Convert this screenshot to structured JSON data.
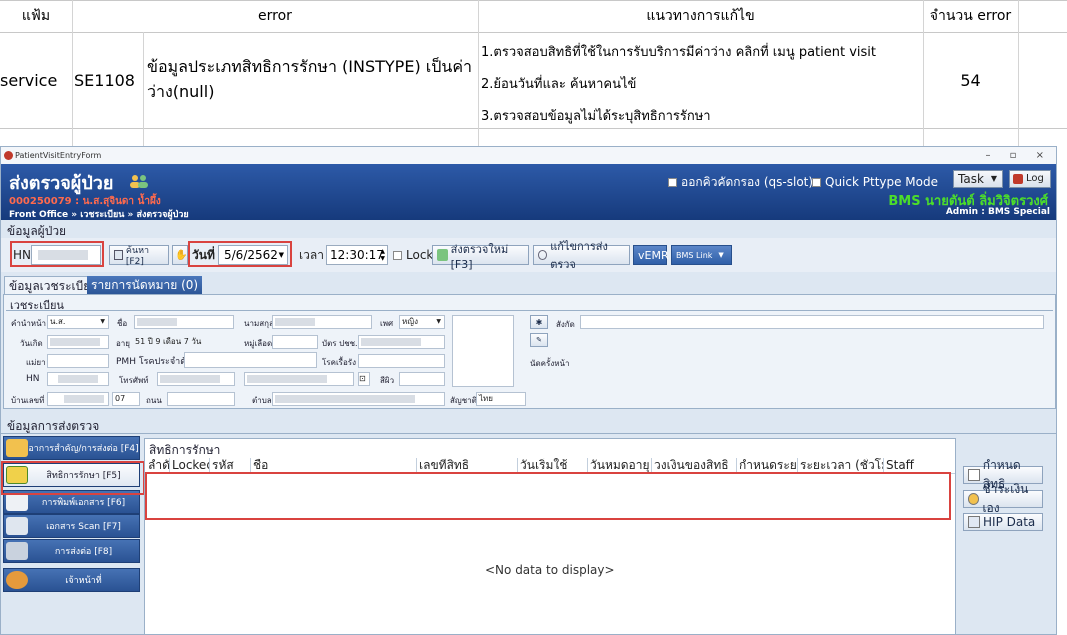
{
  "error_table": {
    "headers": {
      "file": "แฟ้ม",
      "error": "error",
      "solution": "แนวทางการแก้ไข",
      "count": "จำนวน error"
    },
    "row": {
      "file": "service",
      "code": "SE1108",
      "message": "ข้อมูลประเภทสิทธิการรักษา (INSTYPE) เป็นค่าว่าง(null)",
      "solutions": [
        "1.ตรวจสอบสิทธิที่ใช้ในการรับบริการมีค่าว่าง  คลิกที่ เมนู patient visit",
        "2.ย้อนวันที่และ ค้นหาคนไข้",
        "3.ตรวจสอบข้อมูลไม่ได้ระบุสิทธิการรักษา"
      ],
      "count": "54"
    }
  },
  "window": {
    "title": "PatientVisitEntryForm",
    "controls": "– ▫ ×",
    "banner": {
      "title": "ส่งตรวจผู้ป่วย",
      "patient_line": "000250079 : น.ส.สุจินดา น้ำผึ้ง",
      "breadcrumb": "Front Office » เวชระเบียน » ส่งตรวจผู้ป่วย",
      "qs_slot": "ออกคิวคัดกรอง (qs-slot)",
      "quick_pttype": "Quick Pttype Mode",
      "task": "Task",
      "log": "Log",
      "user": "BMS นายตันต์ ลิ่มวิจิตรวงศ์",
      "role": "Admin : BMS Special"
    },
    "patient_section": "ข้อมูลผู้ป่วย",
    "toolbar": {
      "hn_label": "HN",
      "search_btn": "ค้นหา [F2]",
      "date_label": "วันที่",
      "date_value": "5/6/2562",
      "time_label": "เวลา",
      "time_value": "12:30:17",
      "lock_label": "Lock",
      "new_visit_btn": "ส่งตรวจใหม่ [F3]",
      "edit_visit_btn": "แก้ไขการส่งตรวจ",
      "vemr_btn": "vEMR",
      "bms_link_btn": "BMS Link"
    },
    "tabs": [
      "ข้อมูลเวชระเบียน",
      "รายการนัดหมาย (0)"
    ],
    "registry": {
      "title": "เวชระเบียน",
      "prefix_label": "คำนำหน้า",
      "prefix_value": "น.ส.",
      "fname_label": "ชื่อ",
      "lname_label": "นามสกุล",
      "sex_label": "เพศ",
      "sex_value": "หญิง",
      "dob_label": "วันเกิด",
      "age_label": "อายุ",
      "age_value": "51 ปี 9 เดือน 7 วัน",
      "blood_label": "หมู่เลือด",
      "cid_label": "บัตร ปชช.",
      "mother_label": "แม่ยา",
      "pmh_label": "PMH โรคประจำตัว",
      "drug_allergy_label": "โรคเรื้อรัง",
      "hn_label": "HN",
      "phone_label": "โทรศัพท์",
      "color_label": "สีผิว",
      "addr_label": "บ้านเลขที่",
      "moo_value": "07",
      "road_label": "ถนน",
      "tambon_label": "ตำบล",
      "nation_label": "สัญชาติ",
      "nation_value": "ไทย",
      "affiliation_label": "สังกัด",
      "appt_label": "นัดครั้งหน้า"
    },
    "visit_section": "ข้อมูลการส่งตรวจ",
    "left_nav": [
      {
        "label": "อาการสำคัญ/การส่งต่อ [F4]",
        "icon": "person-icon"
      },
      {
        "label": "สิทธิการรักษา [F5]",
        "icon": "card-icon"
      },
      {
        "label": "การพิมพ์เอกสาร [F6]",
        "icon": "printer-icon"
      },
      {
        "label": "เอกสาร Scan [F7]",
        "icon": "scan-icon"
      },
      {
        "label": "การส่งต่อ [F8]",
        "icon": "referral-icon"
      },
      {
        "label": "เจ้าหน้าที่",
        "icon": "staff-icon"
      }
    ],
    "rights": {
      "title": "สิทธิการรักษา",
      "columns": [
        "ลำดับ",
        "Locked",
        "รหัส",
        "ชื่อ",
        "เลขที่สิทธิ",
        "วันเริ่มใช้",
        "วันหมดอายุ",
        "วงเงินของสิทธิ",
        "กำหนดระยะ",
        "ระยะเวลา (ชั่วโมง)",
        "Staff"
      ],
      "empty": "<No data to display>",
      "side_buttons": [
        "กำหนดสิทธิ",
        "ชำระเงินเอง",
        "HIP Data"
      ]
    }
  },
  "colors": {
    "banner": "#1f4a95",
    "accent_red": "#d9433f",
    "user_green": "#4cde2a"
  }
}
